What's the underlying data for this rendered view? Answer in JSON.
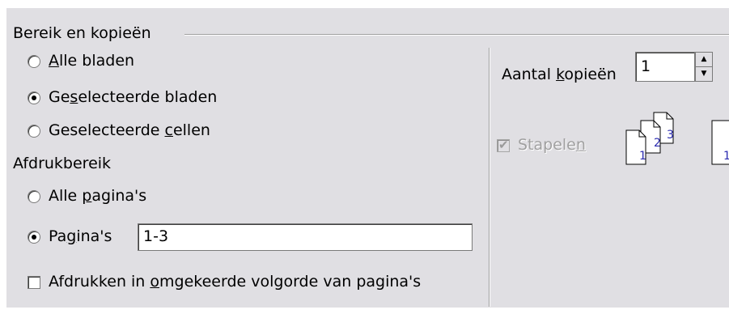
{
  "group": {
    "title": "Bereik en kopieën"
  },
  "range_options": [
    {
      "label_pre": "",
      "accel": "A",
      "label_post": "lle bladen",
      "selected": false
    },
    {
      "label_pre": "Ge",
      "accel": "s",
      "label_post": "electeerde bladen",
      "selected": true
    },
    {
      "label_pre": "Geselecteerde ",
      "accel": "c",
      "label_post": "ellen",
      "selected": false
    }
  ],
  "print_range": {
    "heading": "Afdrukbereik",
    "all_pages": {
      "label_pre": "Alle ",
      "accel": "p",
      "label_post": "agina's",
      "selected": false
    },
    "pages": {
      "label_pre": "Pa",
      "accel": "g",
      "label_post": "ina's",
      "selected": true,
      "value": "1-3"
    },
    "reverse": {
      "label_pre": "Afdrukken in ",
      "accel": "o",
      "label_post": "mgekeerde volgorde van pagina's",
      "checked": false
    }
  },
  "copies": {
    "label_pre": "Aantal ",
    "accel": "k",
    "label_post": "opieën",
    "value": "1",
    "spin_up": "▲",
    "spin_down": "▼"
  },
  "collate": {
    "label_pre": "Stapele",
    "accel": "n",
    "label_post": "",
    "checked": true,
    "enabled": false,
    "tick": "✔"
  },
  "collate_pages": {
    "p1": "1",
    "p2": "2",
    "p3": "3",
    "next": "1"
  }
}
